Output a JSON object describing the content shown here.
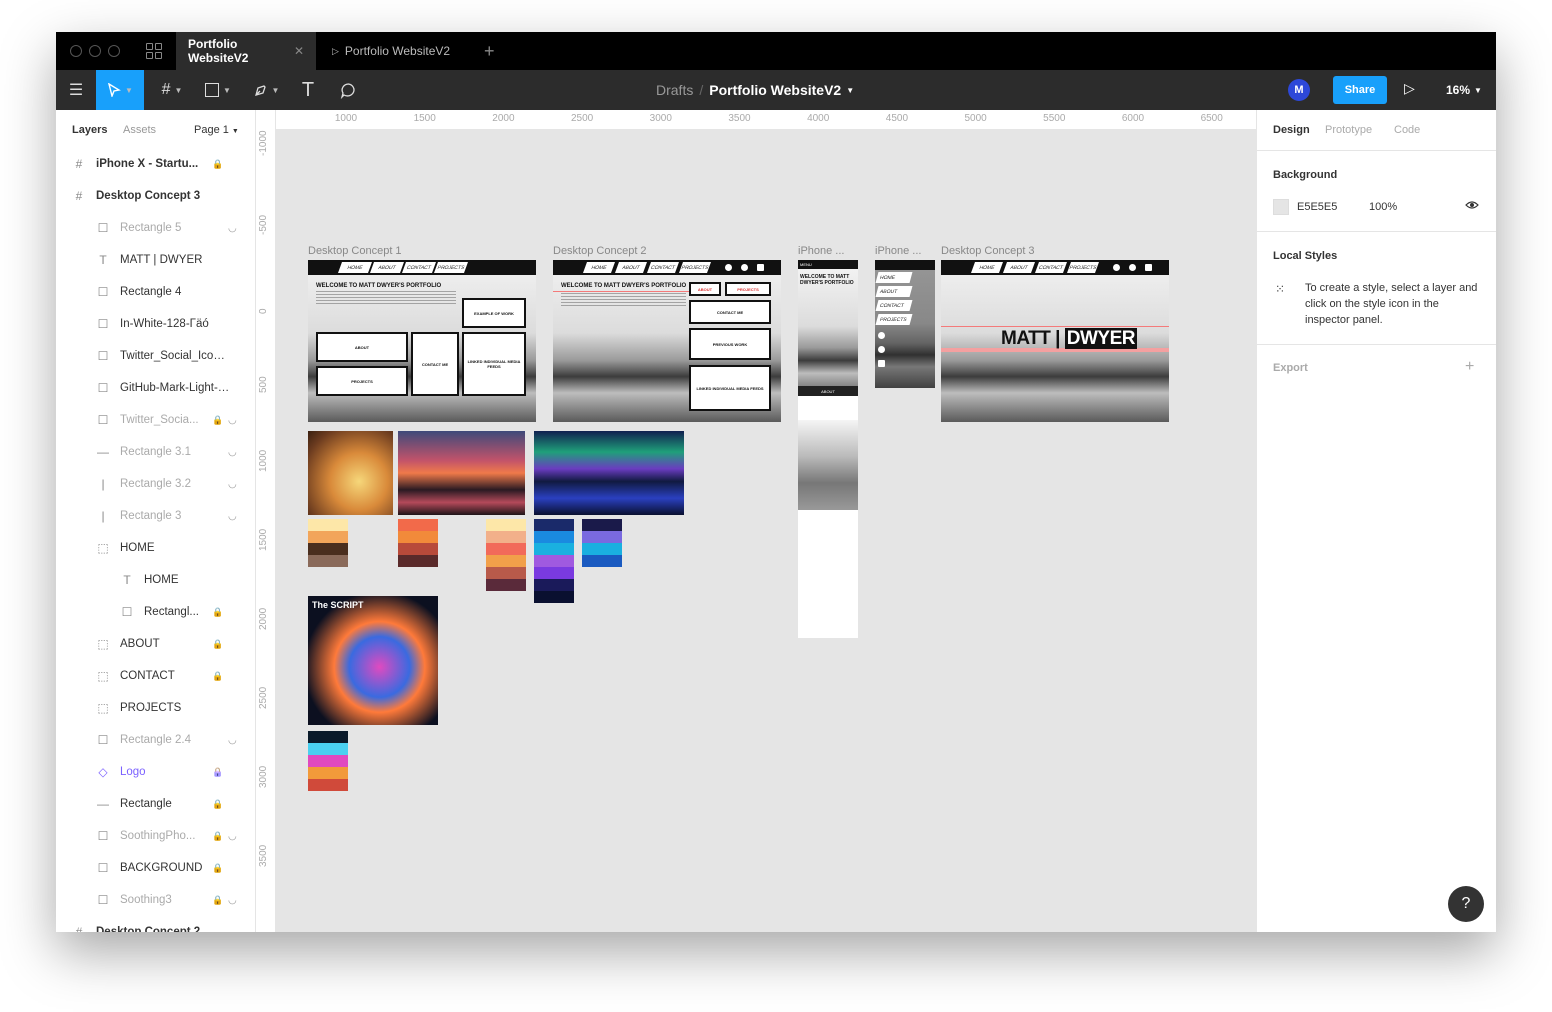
{
  "tabs": [
    {
      "label": "Portfolio WebsiteV2",
      "close": "✕"
    },
    {
      "label": "Portfolio WebsiteV2"
    }
  ],
  "toolbar": {
    "breadcrumb_drafts": "Drafts",
    "breadcrumb_sep": "/",
    "file_name": "Portfolio WebsiteV2",
    "avatar_initial": "M",
    "share_label": "Share",
    "zoom_level": "16%"
  },
  "left_panel": {
    "tab_layers": "Layers",
    "tab_assets": "Assets",
    "page_label": "Page 1",
    "layers": [
      {
        "name": "iPhone X - Startu...",
        "type": "frame",
        "locked": true,
        "hidden": false
      },
      {
        "name": "Desktop Concept 3",
        "type": "frame",
        "locked": false,
        "hidden": false
      },
      {
        "name": "Rectangle 5",
        "type": "rect",
        "locked": false,
        "hidden": true
      },
      {
        "name": "MATT | DWYER",
        "type": "text",
        "locked": false,
        "hidden": false
      },
      {
        "name": "Rectangle 4",
        "type": "rect",
        "locked": false,
        "hidden": false
      },
      {
        "name": "In-White-128-Γäó",
        "type": "rect",
        "locked": false,
        "hidden": false
      },
      {
        "name": "Twitter_Social_Icon_Ci...",
        "type": "rect",
        "locked": false,
        "hidden": false
      },
      {
        "name": "GitHub-Mark-Light-64...",
        "type": "rect",
        "locked": false,
        "hidden": false
      },
      {
        "name": "Twitter_Socia...",
        "type": "rect",
        "locked": true,
        "hidden": true
      },
      {
        "name": "Rectangle 3.1",
        "type": "line",
        "locked": false,
        "hidden": true
      },
      {
        "name": "Rectangle 3.2",
        "type": "vline",
        "locked": false,
        "hidden": true
      },
      {
        "name": "Rectangle 3",
        "type": "vline",
        "locked": false,
        "hidden": true
      },
      {
        "name": "HOME",
        "type": "group",
        "locked": false,
        "hidden": false
      },
      {
        "name": "HOME",
        "type": "text",
        "locked": false,
        "hidden": false
      },
      {
        "name": "Rectangl...",
        "type": "rect",
        "locked": true,
        "hidden": false
      },
      {
        "name": "ABOUT",
        "type": "group",
        "locked": true,
        "hidden": false
      },
      {
        "name": "CONTACT",
        "type": "group",
        "locked": true,
        "hidden": false
      },
      {
        "name": "PROJECTS",
        "type": "group",
        "locked": false,
        "hidden": false
      },
      {
        "name": "Rectangle 2.4",
        "type": "rect",
        "locked": false,
        "hidden": true
      },
      {
        "name": "Logo",
        "type": "component",
        "locked": true,
        "hidden": false
      },
      {
        "name": "Rectangle",
        "type": "line",
        "locked": true,
        "hidden": false
      },
      {
        "name": "SoothingPho...",
        "type": "rect",
        "locked": true,
        "hidden": true
      },
      {
        "name": "BACKGROUND",
        "type": "rect",
        "locked": true,
        "hidden": false
      },
      {
        "name": "Soothing3",
        "type": "rect",
        "locked": true,
        "hidden": true
      },
      {
        "name": "Desktop Concept 2",
        "type": "frame",
        "locked": false,
        "hidden": false
      }
    ]
  },
  "canvas": {
    "ruler_x": [
      "1000",
      "1500",
      "2000",
      "2500",
      "3000",
      "3500",
      "4000",
      "4500",
      "5000",
      "5500",
      "6000",
      "6500"
    ],
    "ruler_y": [
      "-1000",
      "-500",
      "0",
      "500",
      "1000",
      "1500",
      "2000",
      "2500",
      "3000",
      "3500"
    ],
    "frame_titles": [
      "Desktop Concept 1",
      "Desktop Concept 2",
      "iPhone ...",
      "iPhone ...",
      "Desktop Concept 3"
    ],
    "hero_heading": "WELCOME TO MATT DWYER'S PORTFOLIO",
    "nav_items": [
      "HOME",
      "ABOUT",
      "CONTACT",
      "PROJECTS"
    ],
    "dc1_boxes": [
      "EXAMPLE OF WORK",
      "ABOUT",
      "CONTACT ME",
      "PROJECTS",
      "LINKED INDIVIDUAL MEDIA FEEDS"
    ],
    "dc2_boxes": [
      "ABOUT",
      "PROJECTS",
      "CONTACT ME",
      "PREVIOUS WORK",
      "LINKED INDIVIDUAL MEDIA FEEDS"
    ],
    "iphone_menu": "MENU",
    "iphone_heading": "WELCOME TO MATT DWYER'S PORTFOLIO",
    "iphone_about": "ABOUT",
    "dc3_name_left": "MATT",
    "dc3_name_sep": "|",
    "dc3_name_right": "DWYER",
    "album_title": "The SCRIPT"
  },
  "right_panel": {
    "tab_design": "Design",
    "tab_prototype": "Prototype",
    "tab_code": "Code",
    "background_title": "Background",
    "background_hex": "E5E5E5",
    "background_opacity": "100%",
    "local_styles_title": "Local Styles",
    "local_styles_hint": "To create a style, select a layer and click on the style icon in the inspector panel.",
    "export_title": "Export"
  },
  "colors": {
    "accent": "#18a0fb",
    "avatar": "#2d48d9",
    "component": "#7b61ff",
    "canvas_bg": "#E5E5E5"
  },
  "help_label": "?"
}
